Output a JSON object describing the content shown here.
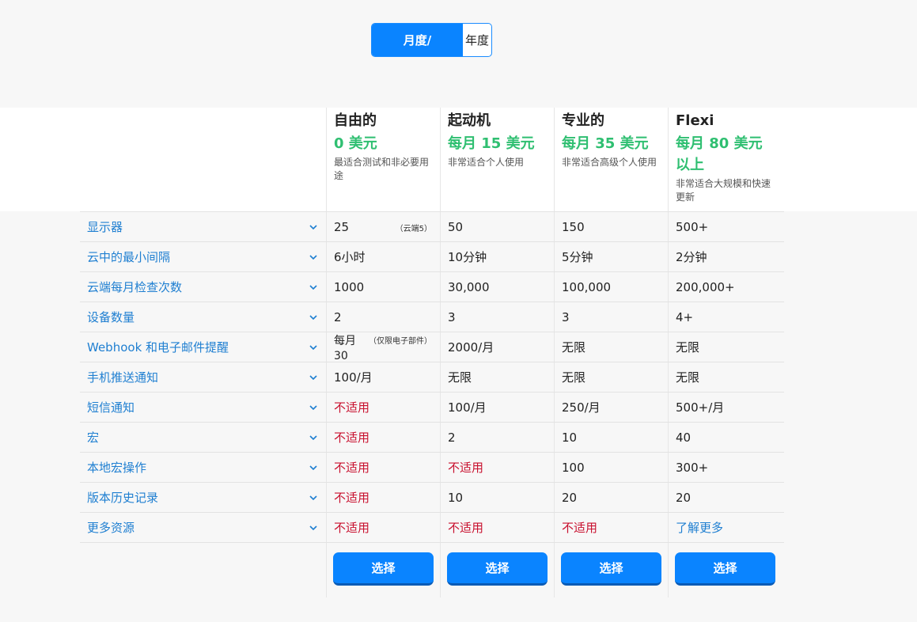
{
  "toggle": {
    "monthly_label": "月度/",
    "annual_label": "年度"
  },
  "plans": [
    {
      "name": "自由的",
      "price": "0 美元",
      "desc": "最适合测试和非必要用途"
    },
    {
      "name": "起动机",
      "price": "每月 15 美元",
      "desc": "非常适合个人使用"
    },
    {
      "name": "专业的",
      "price": "每月 35 美元",
      "desc": "非常适合高级个人使用"
    },
    {
      "name": "Flexi",
      "price": "每月 80 美元以上",
      "desc": "非常适合大规模和快速更新"
    }
  ],
  "rows": [
    {
      "label": "显示器",
      "cells": [
        "25",
        "50",
        "150",
        "500+"
      ],
      "note": "（云端5）"
    },
    {
      "label": "云中的最小间隔",
      "cells": [
        "6小时",
        "10分钟",
        "5分钟",
        "2分钟"
      ]
    },
    {
      "label": "云端每月检查次数",
      "cells": [
        "1000",
        "30,000",
        "100,000",
        "200,000+"
      ]
    },
    {
      "label": "设备数量",
      "cells": [
        "2",
        "3",
        "3",
        "4+"
      ]
    },
    {
      "label": "Webhook 和电子邮件提醒",
      "cells": [
        "每月30",
        "2000/月",
        "无限",
        "无限"
      ],
      "note": "（仅限电子部件）"
    },
    {
      "label": "手机推送通知",
      "cells": [
        "100/月",
        "无限",
        "无限",
        "无限"
      ]
    },
    {
      "label": "短信通知",
      "cells": [
        "不适用",
        "100/月",
        "250/月",
        "500+/月"
      ]
    },
    {
      "label": "宏",
      "cells": [
        "不适用",
        "2",
        "10",
        "40"
      ]
    },
    {
      "label": "本地宏操作",
      "cells": [
        "不适用",
        "不适用",
        "100",
        "300+"
      ]
    },
    {
      "label": "版本历史记录",
      "cells": [
        "不适用",
        "10",
        "20",
        "20"
      ]
    },
    {
      "label": "更多资源",
      "cells": [
        "不适用",
        "不适用",
        "不适用",
        "了解更多"
      ]
    }
  ],
  "select_label": "选择",
  "colors": {
    "accent": "#0a84ff",
    "price": "#2fbf71",
    "na": "#c8102e",
    "link": "#1f7fd1"
  }
}
